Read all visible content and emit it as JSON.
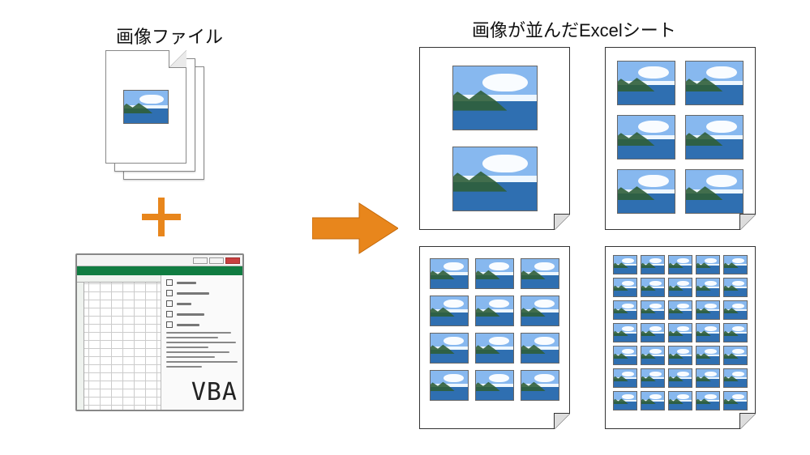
{
  "labels": {
    "left_title": "画像ファイル",
    "right_title": "画像が並んだExcelシート"
  },
  "icons": {
    "image_file": "image-file-icon",
    "plus": "plus-icon",
    "arrow": "arrow-right-icon",
    "excel_window": "excel-vba-window-icon",
    "page_curl": "page-curl-icon"
  },
  "excel_window": {
    "vba_badge": "VBA",
    "checklist_item_count": 5,
    "code_line_count": 8
  },
  "output_sheets": [
    {
      "id": "page-a",
      "columns": 1,
      "rows": 2,
      "image_count": 2
    },
    {
      "id": "page-b",
      "columns": 2,
      "rows": 3,
      "image_count": 6
    },
    {
      "id": "page-c",
      "columns": 3,
      "rows": 4,
      "image_count": 12
    },
    {
      "id": "page-d",
      "columns": 5,
      "rows": 7,
      "image_count": 35
    }
  ],
  "colors": {
    "accent_orange": "#e8861c",
    "excel_green": "#107c41"
  }
}
